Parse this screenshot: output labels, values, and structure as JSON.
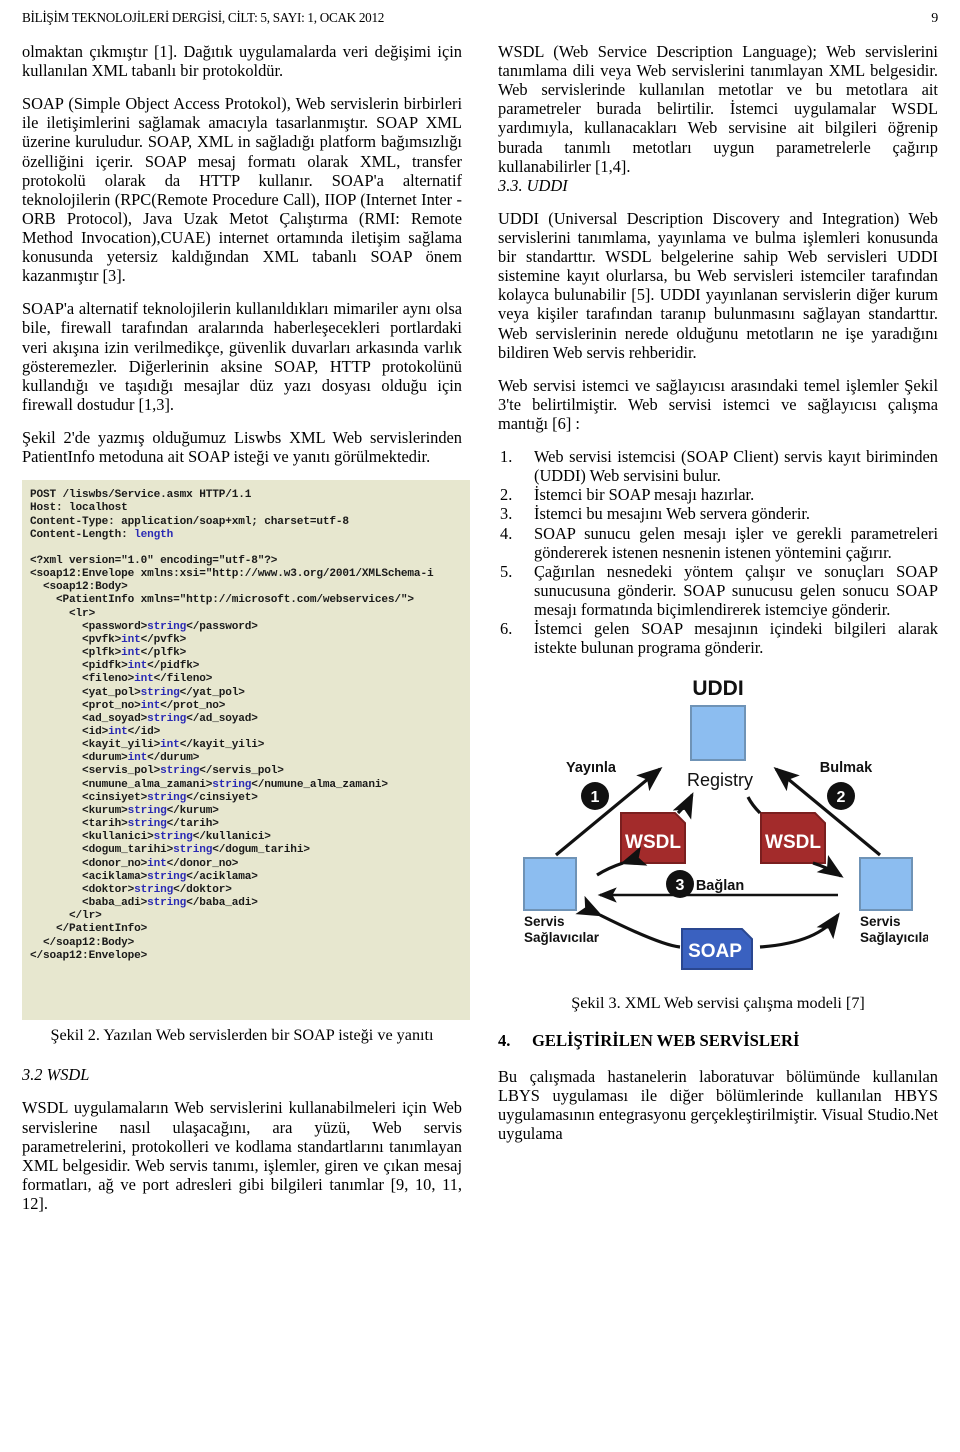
{
  "running_head": {
    "journal_line": "BİLİŞİM TEKNOLOJİLERİ DERGİSİ, CİLT: 5, SAYI: 1, OCAK 2012",
    "page_number": "9"
  },
  "left_column": {
    "paragraph_1": "olmaktan çıkmıştır [1]. Dağıtık uygulamalarda veri değişimi için kullanılan XML tabanlı bir protokoldür.",
    "paragraph_2": "SOAP (Simple Object Access Protokol), Web servislerin birbirleri ile iletişimlerini sağlamak amacıyla tasarlanmıştır. SOAP XML üzerine kuruludur. SOAP, XML in sağladığı platform bağımsızlığı özelliğini içerir. SOAP mesaj formatı olarak XML, transfer protokolü olarak da HTTP kullanır. SOAP'a alternatif teknolojilerin (RPC(Remote Procedure Call), IIOP (Internet Inter - ORB Protocol), Java Uzak Metot Çalıştırma (RMI: Remote Method Invocation),CUAE) internet ortamında iletişim sağlama konusunda yetersiz kaldığından XML tabanlı SOAP önem kazanmıştır [3].",
    "paragraph_3": "SOAP'a alternatif teknolojilerin kullanıldıkları mimariler aynı olsa bile, firewall tarafından aralarında haberleşecekleri portlardaki veri akışına izin verilmedikçe, güvenlik duvarları arkasında varlık gösteremezler. Diğerlerinin aksine SOAP, HTTP protokolünü kullandığı ve taşıdığı mesajlar düz yazı dosyası olduğu için firewall dostudur [1,3].",
    "paragraph_4": "Şekil 2'de yazmış olduğumuz Liswbs XML Web servislerinden PatientInfo metoduna ait SOAP isteği ve yanıtı görülmektedir.",
    "figure_2_caption": "Şekil 2. Yazılan Web servislerden bir SOAP isteği ve yanıtı",
    "subheading_wsdl": "3.2 WSDL",
    "paragraph_5": "WSDL uygulamaların Web servislerini kullanabilmeleri için Web servislerine nasıl ulaşacağını, ara yüzü, Web servis parametrelerini, protokolleri ve kodlama standartlarını tanımlayan XML belgesidir. Web servis tanımı, işlemler, giren ve çıkan mesaj formatları, ağ ve port adresleri gibi bilgileri tanımlar [9, 10, 11, 12]."
  },
  "code_listing": {
    "background_color": "#e7e7cf",
    "value_color": "#2a2ab4",
    "lines": [
      {
        "t": "POST /liswbs/Service.asmx HTTP/1.1"
      },
      {
        "t": "Host: localhost"
      },
      {
        "t": "Content-Type: application/soap+xml; charset=utf-8"
      },
      {
        "t": "Content-Length: ",
        "v": "length"
      },
      {
        "t": ""
      },
      {
        "t": "<?xml version=\"1.0\" encoding=\"utf-8\"?>"
      },
      {
        "t": "<soap12:Envelope xmlns:xsi=\"http://www.w3.org/2001/XMLSchema-i"
      },
      {
        "t": "  <soap12:Body>"
      },
      {
        "t": "    <PatientInfo xmlns=\"http://microsoft.com/webservices/\">"
      },
      {
        "t": "      <lr>"
      },
      {
        "t": "        <password>",
        "v": "string",
        "t2": "</password>"
      },
      {
        "t": "        <pvfk>",
        "v": "int",
        "t2": "</pvfk>"
      },
      {
        "t": "        <plfk>",
        "v": "int",
        "t2": "</plfk>"
      },
      {
        "t": "        <pidfk>",
        "v": "int",
        "t2": "</pidfk>"
      },
      {
        "t": "        <fileno>",
        "v": "int",
        "t2": "</fileno>"
      },
      {
        "t": "        <yat_pol>",
        "v": "string",
        "t2": "</yat_pol>"
      },
      {
        "t": "        <prot_no>",
        "v": "int",
        "t2": "</prot_no>"
      },
      {
        "t": "        <ad_soyad>",
        "v": "string",
        "t2": "</ad_soyad>"
      },
      {
        "t": "        <id>",
        "v": "int",
        "t2": "</id>"
      },
      {
        "t": "        <kayit_yili>",
        "v": "int",
        "t2": "</kayit_yili>"
      },
      {
        "t": "        <durum>",
        "v": "int",
        "t2": "</durum>"
      },
      {
        "t": "        <servis_pol>",
        "v": "string",
        "t2": "</servis_pol>"
      },
      {
        "t": "        <numune_alma_zamani>",
        "v": "string",
        "t2": "</numune_alma_zamani>"
      },
      {
        "t": "        <cinsiyet>",
        "v": "string",
        "t2": "</cinsiyet>"
      },
      {
        "t": "        <kurum>",
        "v": "string",
        "t2": "</kurum>"
      },
      {
        "t": "        <tarih>",
        "v": "string",
        "t2": "</tarih>"
      },
      {
        "t": "        <kullanici>",
        "v": "string",
        "t2": "</kullanici>"
      },
      {
        "t": "        <dogum_tarihi>",
        "v": "string",
        "t2": "</dogum_tarihi>"
      },
      {
        "t": "        <donor_no>",
        "v": "int",
        "t2": "</donor_no>"
      },
      {
        "t": "        <aciklama>",
        "v": "string",
        "t2": "</aciklama>"
      },
      {
        "t": "        <doktor>",
        "v": "string",
        "t2": "</doktor>"
      },
      {
        "t": "        <baba_adi>",
        "v": "string",
        "t2": "</baba_adi>"
      },
      {
        "t": "      </lr>"
      },
      {
        "t": "    </PatientInfo>"
      },
      {
        "t": "  </soap12:Body>"
      },
      {
        "t": "</soap12:Envelope>"
      }
    ]
  },
  "right_column": {
    "paragraph_1": "WSDL (Web Service Description Language); Web servislerini tanımlama dili veya Web servislerini tanımlayan XML belgesidir. Web servislerinde kullanılan metotlar ve bu metotlara ait parametreler burada belirtilir. İstemci uygulamalar WSDL yardımıyla, kullanacakları Web servisine ait bilgileri öğrenip burada tanımlı metotları uygun parametrelerle çağırıp kullanabilirler [1,4].",
    "subheading_uddi": "3.3. UDDI",
    "paragraph_2": "UDDI (Universal Description Discovery and Integration) Web servislerini tanımlama, yayınlama ve bulma işlemleri konusunda bir standarttır. WSDL belgelerine sahip Web servisleri UDDI sistemine kayıt olurlarsa, bu Web servisleri istemciler tarafından kolayca bulunabilir [5]. UDDI yayınlanan servislerin diğer kurum veya kişiler tarafından taranıp bulunmasını sağlayan standarttır. Web servislerinin nerede olduğunu metotların ne işe yaradığını bildiren Web servis rehberidir.",
    "paragraph_3": "Web servisi istemci ve sağlayıcısı arasındaki temel işlemler Şekil 3'te belirtilmiştir. Web servisi istemci ve sağlayıcısı çalışma mantığı [6] :",
    "steps": [
      {
        "num": "1.",
        "text": "Web servisi istemcisi (SOAP Client) servis kayıt biriminden (UDDI) Web servisini bulur."
      },
      {
        "num": "2.",
        "text": "İstemci bir SOAP mesajı hazırlar."
      },
      {
        "num": "3.",
        "text": "İstemci bu mesajını Web servera gönderir."
      },
      {
        "num": "4.",
        "text": "SOAP sunucu gelen mesajı işler ve gerekli parametreleri göndererek istenen nesnenin istenen yöntemini çağırır."
      },
      {
        "num": "5.",
        "text": "Çağırılan nesnedeki yöntem çalışır ve sonuçları SOAP sunucusuna gönderir. SOAP sunucusu gelen sonucu SOAP mesajı formatında biçimlendirerek istemciye gönderir."
      },
      {
        "num": "6.",
        "text": "İstemci gelen SOAP mesajının içindeki bilgileri alarak istekte bulunan programa gönderir."
      }
    ],
    "figure_3_caption": "Şekil 3. XML Web servisi çalışma modeli [7]",
    "section_4_number": "4.",
    "section_4_title": "GELİŞTİRİLEN WEB SERVİSLERİ",
    "paragraph_4": "Bu çalışmada hastanelerin laboratuvar bölümünde kullanılan LBYS uygulaması ile diğer bölümlerinde kullanılan HBYS uygulamasının entegrasyonu gerçekleştirilmiştir. Visual Studio.Net uygulama"
  },
  "uddi_diagram": {
    "title": "UDDI",
    "registry_label": "Registry",
    "publish_label": "Yayınla",
    "find_label": "Bulmak",
    "bind_label": "Bağlan",
    "step_1": "1",
    "step_2": "2",
    "step_3": "3",
    "wsdl_left_label": "WSDL",
    "wsdl_right_label": "WSDL",
    "soap_label": "SOAP",
    "left_actor_line1": "Servis",
    "left_actor_line2": "Sağlavıcılar",
    "right_actor_line1": "Servis",
    "right_actor_line2": "Sağlayıcılar",
    "colors": {
      "box_blue": "#8cbdf0",
      "box_blue_border": "#6f93b6",
      "wsdl_red": "#a32b2b",
      "wsdl_red_border": "#7a1f1f",
      "soap_blue": "#3a61c0",
      "soap_blue_border": "#2a4790",
      "arrow": "#111111",
      "badge": "#111111"
    }
  }
}
